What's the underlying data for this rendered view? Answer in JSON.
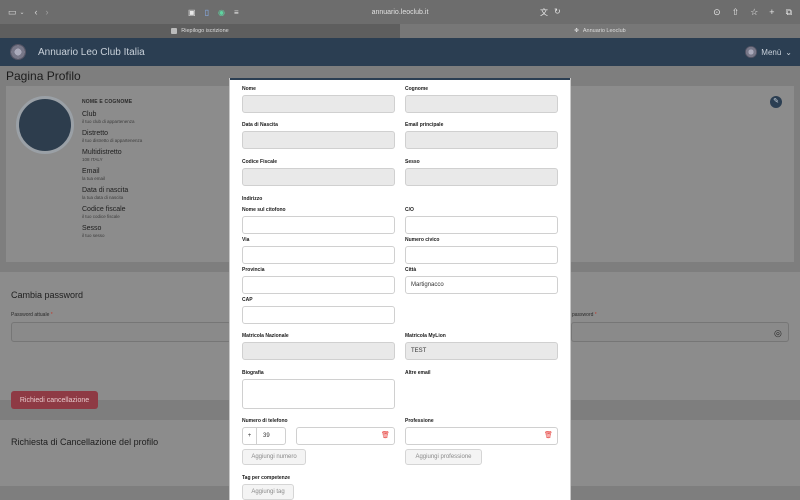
{
  "browser": {
    "url": "annuario.leoclub.it",
    "tabs": [
      {
        "label": "Riepilogo iscrizione"
      },
      {
        "label": "Annuario Leoclub"
      }
    ]
  },
  "app": {
    "title": "Annuario Leo Club Italia",
    "menu_label": "Menù"
  },
  "profile": {
    "page_title": "Pagina Profilo",
    "name_heading": "NOME E COGNOME",
    "fields": [
      {
        "label": "Club",
        "value": "il tuo club di appartenenza"
      },
      {
        "label": "Distretto",
        "value": "il tuo distretto di appartenenza"
      },
      {
        "label": "Multidistretto",
        "value": "108 ITALY"
      },
      {
        "label": "Email",
        "value": "la tua email"
      },
      {
        "label": "Data di nascita",
        "value": "la tua data di nascita"
      },
      {
        "label": "Codice fiscale",
        "value": "il tuo codice fiscale"
      },
      {
        "label": "Sesso",
        "value": "il tuo sesso"
      }
    ]
  },
  "password": {
    "title": "Cambia password",
    "current_label": "Password attuale",
    "required_mark": "*",
    "right_label": "password",
    "right_required_mark": "*"
  },
  "deletion": {
    "title": "Richiesta di Cancellazione del profilo",
    "button": "Richiedi cancellazione"
  },
  "modal": {
    "nome_label": "Nome",
    "cognome_label": "Cognome",
    "data_nascita_label": "Data di Nascita",
    "email_label": "Email principale",
    "codice_fiscale_label": "Codice Fiscale",
    "sesso_label": "Sesso",
    "indirizzo_label": "Indirizzo",
    "citofono_label": "Nome sul citofono",
    "co_label": "C/O",
    "via_label": "Via",
    "civico_label": "Numero civico",
    "provincia_label": "Provincia",
    "citta_label": "Città",
    "citta_value": "Martignacco",
    "cap_label": "CAP",
    "matricola_nazionale_label": "Matricola Nazionale",
    "matricola_mylion_label": "Matricola MyLion",
    "matricola_mylion_value": "TEST",
    "biografia_label": "Biografia",
    "altre_email_label": "Altre email",
    "telefono_label": "Numero di telefono",
    "telefono_prefix_sign": "+",
    "telefono_prefix_value": "39",
    "professione_label": "Professione",
    "aggiungi_numero": "Aggiungi numero",
    "aggiungi_professione": "Aggiungi professione",
    "tag_label": "Tag per competenze",
    "aggiungi_tag": "Aggiungi tag"
  }
}
